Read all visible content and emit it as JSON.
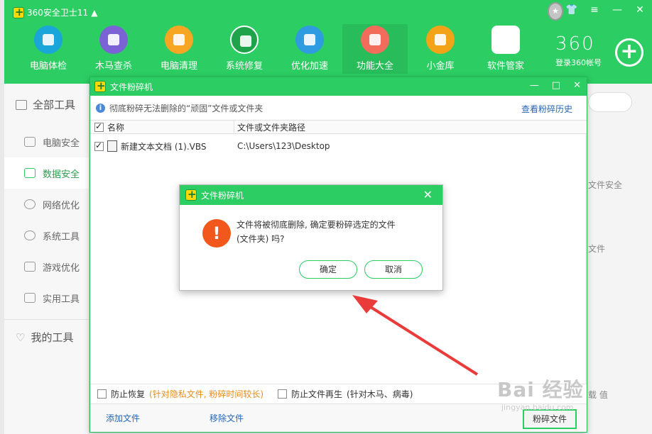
{
  "app": {
    "title": "360安全卫士11",
    "brand_num": "360",
    "login_label": "登录360帐号"
  },
  "nav": [
    {
      "label": "电脑体检",
      "color": "#1aa6d8"
    },
    {
      "label": "木马查杀",
      "color": "#7b63d6"
    },
    {
      "label": "电脑清理",
      "color": "#f7a623"
    },
    {
      "label": "系统修复",
      "color": "#1fa34a"
    },
    {
      "label": "优化加速",
      "color": "#2f9be0"
    },
    {
      "label": "功能大全",
      "color": "#f26c5c"
    },
    {
      "label": "小金库",
      "color": "#f2a317"
    },
    {
      "label": "软件管家",
      "color": "#2ccd62"
    }
  ],
  "sidebar": {
    "head": "全部工具",
    "items": [
      "电脑安全",
      "数据安全",
      "网络优化",
      "系统工具",
      "游戏优化",
      "实用工具"
    ],
    "mine": "我的工具"
  },
  "bg": {
    "text1": "文件安全",
    "text2": "文件",
    "text3": "载 值"
  },
  "shredder": {
    "title": "文件粉碎机",
    "info": "彻底粉碎无法删除的“顽固”文件或文件夹",
    "history": "查看粉碎历史",
    "col_name": "名称",
    "col_path": "文件或文件夹路径",
    "rows": [
      {
        "name": "新建文本文档 (1).VBS",
        "path": "C:\\Users\\123\\Desktop"
      }
    ],
    "opt1_label": "防止恢复",
    "opt1_note": "(针对隐私文件, 粉碎时间较长)",
    "opt2_label": "防止文件再生",
    "opt2_note": "(针对木马、病毒)",
    "add_file": "添加文件",
    "remove_file": "移除文件",
    "shred_btn": "粉碎文件"
  },
  "confirm": {
    "title": "文件粉碎机",
    "message_line1": "文件将被彻底删除, 确定要粉碎选定的文件",
    "message_line2": "(文件夹) 吗?",
    "ok": "确定",
    "cancel": "取消"
  },
  "watermark": {
    "main": "Bai 经验",
    "sub": "jingyan.baidu.com"
  },
  "colors": {
    "brand_green": "#2ccd62",
    "warn_orange": "#f2581c",
    "arrow_red": "#ea3b3b"
  }
}
